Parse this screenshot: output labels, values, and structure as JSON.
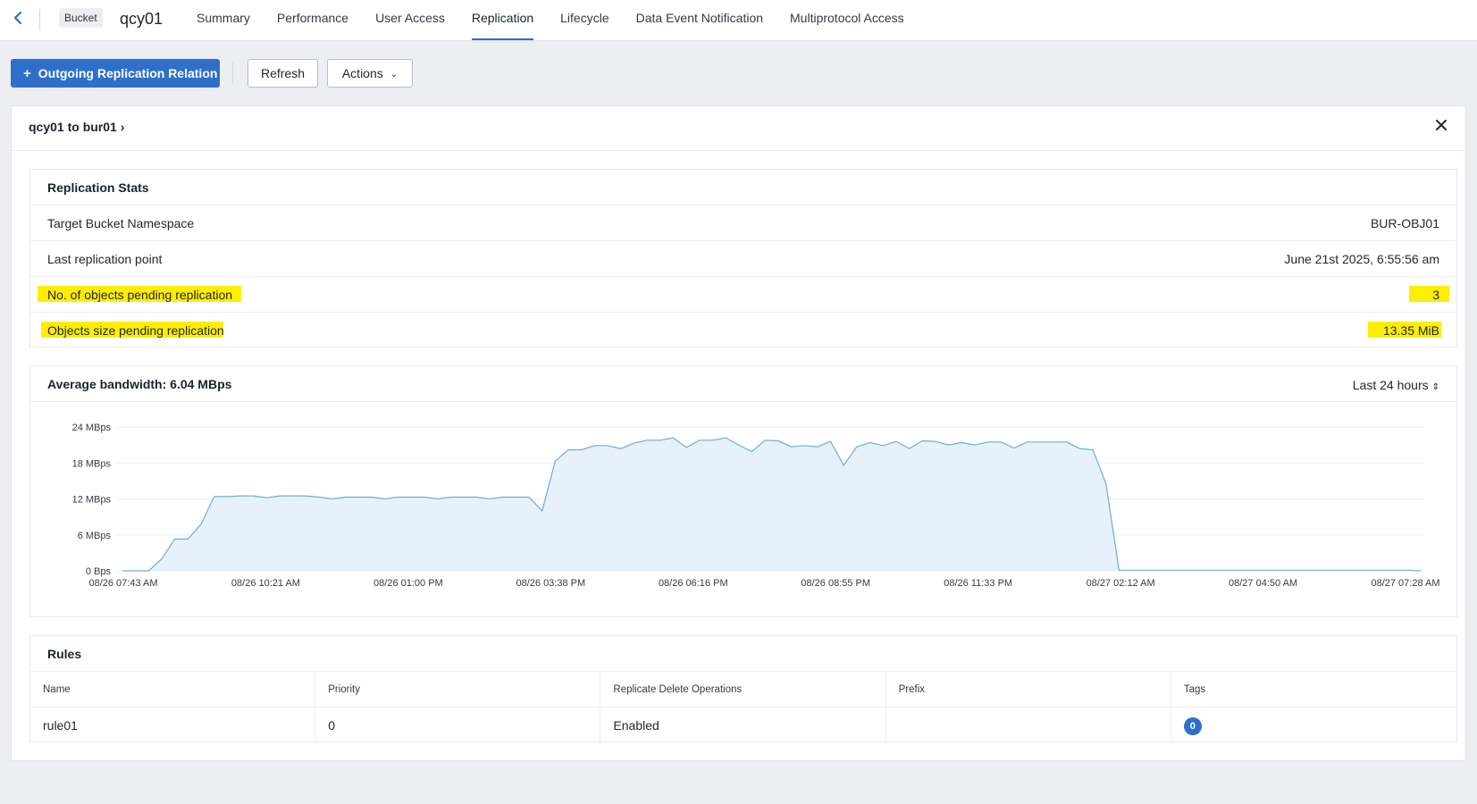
{
  "nav": {
    "badge": "Bucket",
    "bucket_name": "qcy01",
    "tabs": [
      {
        "label": "Summary"
      },
      {
        "label": "Performance"
      },
      {
        "label": "User Access"
      },
      {
        "label": "Replication",
        "active": true
      },
      {
        "label": "Lifecycle"
      },
      {
        "label": "Data Event Notification"
      },
      {
        "label": "Multiprotocol Access"
      }
    ]
  },
  "toolbar": {
    "primary_label": "Outgoing Replication Relation",
    "refresh_label": "Refresh",
    "actions_label": "Actions"
  },
  "relation": {
    "title": "qcy01 to bur01 ›"
  },
  "stats": {
    "title": "Replication Stats",
    "rows": [
      {
        "label": "Target Bucket Namespace",
        "value": "BUR-OBJ01"
      },
      {
        "label": "Last replication point",
        "value": "June 21st 2025, 6:55:56 am"
      },
      {
        "label": "No. of objects pending replication",
        "value": "3",
        "highlighted": true
      },
      {
        "label": "Objects size pending replication",
        "value": "13.35 MiB",
        "highlighted": true
      }
    ]
  },
  "bandwidth": {
    "title": "Average bandwidth: 6.04 MBps",
    "range_label": "Last 24 hours"
  },
  "chart_data": {
    "type": "area",
    "ylim": [
      0,
      24
    ],
    "y_ticks": [
      {
        "value": 0,
        "label": "0 Bps"
      },
      {
        "value": 6,
        "label": "6 MBps"
      },
      {
        "value": 12,
        "label": "12 MBps"
      },
      {
        "value": 18,
        "label": "18 MBps"
      },
      {
        "value": 24,
        "label": "24 MBps"
      }
    ],
    "x_ticks": [
      "08/26 07:43 AM",
      "08/26 10:21 AM",
      "08/26 01:00 PM",
      "08/26 03:38 PM",
      "08/26 06:16 PM",
      "08/26 08:55 PM",
      "08/26 11:33 PM",
      "08/27 02:12 AM",
      "08/27 04:50 AM",
      "08/27 07:28 AM"
    ],
    "grid": true,
    "colors": {
      "line": "#6aaed6",
      "fill": "#e6f1fb"
    },
    "values": [
      0,
      0,
      0,
      2,
      5.3,
      5.3,
      7.8,
      12.4,
      12.4,
      12.5,
      12.5,
      12.2,
      12.5,
      12.5,
      12.5,
      12.3,
      12.0,
      12.3,
      12.3,
      12.3,
      12.0,
      12.3,
      12.3,
      12.3,
      12.0,
      12.3,
      12.3,
      12.3,
      12.0,
      12.3,
      12.3,
      12.3,
      10.0,
      18.3,
      20.2,
      20.2,
      20.9,
      20.9,
      20.4,
      21.3,
      21.8,
      21.8,
      22.2,
      20.6,
      21.8,
      21.8,
      22.2,
      21.0,
      19.9,
      21.8,
      21.7,
      20.7,
      20.9,
      20.7,
      21.6,
      17.6,
      20.7,
      21.4,
      20.9,
      21.6,
      20.4,
      21.7,
      21.6,
      21.0,
      21.4,
      21.0,
      21.5,
      21.5,
      20.5,
      21.5,
      21.5,
      21.5,
      21.5,
      20.4,
      20.2,
      14.5,
      0.1,
      0.1,
      0.1,
      0.1,
      0.1,
      0.1,
      0.1,
      0.1,
      0.1,
      0.1,
      0.1,
      0.1,
      0.1,
      0.1,
      0.1,
      0.1,
      0.1,
      0.1,
      0.1,
      0.1,
      0.1,
      0.1,
      0.1,
      0
    ]
  },
  "rules": {
    "title": "Rules",
    "columns": [
      "Name",
      "Priority",
      "Replicate Delete Operations",
      "Prefix",
      "Tags"
    ],
    "rows": [
      {
        "name": "rule01",
        "priority": "0",
        "delete_ops": "Enabled",
        "prefix": "",
        "tags": "0"
      }
    ]
  }
}
